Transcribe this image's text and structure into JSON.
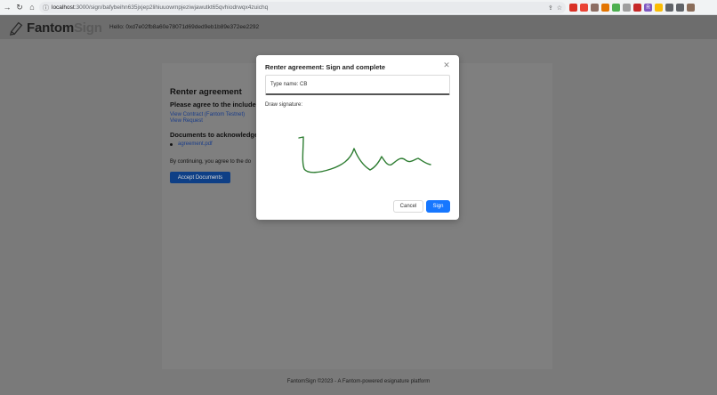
{
  "browser": {
    "url_host": "localhost",
    "url_path": ":3000/sign/bafybeihn635jxjep2lihiuuowmpjeziwjawutkt65qvhiodrwqx4zuichq",
    "info_icon": "info-icon",
    "share_icon": "share-icon",
    "star_icon": "star-icon",
    "extensions": [
      {
        "name": "ext-a",
        "color": "#d93025",
        "glyph": ""
      },
      {
        "name": "ext-b",
        "color": "#ea4335",
        "glyph": ""
      },
      {
        "name": "ext-c",
        "color": "#8d6e63",
        "glyph": ""
      },
      {
        "name": "ext-d",
        "color": "#e37400",
        "glyph": ""
      },
      {
        "name": "ext-e",
        "color": "#4caf50",
        "glyph": ""
      },
      {
        "name": "ext-f",
        "color": "#9e9e9e",
        "glyph": ""
      },
      {
        "name": "ext-g",
        "color": "#c62828",
        "glyph": ""
      },
      {
        "name": "ext-h",
        "color": "#7e57c2",
        "glyph": "R"
      },
      {
        "name": "ext-i",
        "color": "#fbbc04",
        "glyph": ""
      },
      {
        "name": "ext-j",
        "color": "#5f6368",
        "glyph": ""
      },
      {
        "name": "ext-k",
        "color": "#5f6368",
        "glyph": ""
      },
      {
        "name": "ext-l",
        "color": "#8a6d5a",
        "glyph": ""
      }
    ]
  },
  "header": {
    "logo_main": "Fantom",
    "logo_light": "Sign",
    "hello": "Hello: 0xd7e02fb8a60e78071d69ded9eb1b89e372ee2292"
  },
  "card": {
    "title": "Renter agreement",
    "agree": "Please agree to the included d",
    "link_contract": "View Contract (Fantom Testnet)",
    "link_request": "View Request",
    "docs_heading": "Documents to acknowledge:",
    "doc": "agreement.pdf",
    "continue_text": "By continuing, you agree to the do",
    "accept_label": "Accept Documents"
  },
  "modal": {
    "title": "Renter agreement: Sign and complete",
    "name_field": "Type name: CB",
    "draw_label": "Draw signature:",
    "cancel_label": "Cancel",
    "sign_label": "Sign",
    "signature_color": "#2e7d32"
  },
  "footer": {
    "text": "FantomSign ©2023 - A Fantom-powered esignature platform"
  },
  "colors": {
    "primary": "#1677ff",
    "accept_button": "#0e3f86"
  }
}
